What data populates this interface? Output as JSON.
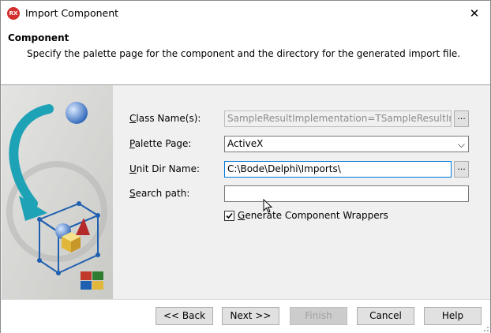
{
  "window": {
    "title": "Import Component",
    "app_icon_text": "RX",
    "close_glyph": "✕"
  },
  "header": {
    "title": "Component",
    "description": "Specify the palette page for the component and the directory for the generated import file."
  },
  "form": {
    "class_name": {
      "label_accel": "C",
      "label_rest": "lass Name(s):",
      "value": "SampleResultImplementation=TSampleResultImplem",
      "enabled": false
    },
    "palette_page": {
      "label_accel": "P",
      "label_rest": "alette Page:",
      "value": "ActiveX"
    },
    "unit_dir": {
      "label_accel": "U",
      "label_rest": "nit Dir Name:",
      "value": "C:\\Bode\\Delphi\\Imports\\"
    },
    "search_path": {
      "label_accel": "S",
      "label_rest": "earch path:",
      "value": ""
    },
    "generate_wrappers": {
      "label_accel": "G",
      "label_rest": "enerate Component Wrappers",
      "checked": true
    },
    "browse_label": "...",
    "dropdown_glyph": "⌵"
  },
  "buttons": {
    "back": "<< Back",
    "next": "Next >>",
    "finish": "Finish",
    "cancel": "Cancel",
    "help": "Help"
  },
  "colors": {
    "accent": "#0078d7",
    "panel": "#f0f0f0",
    "art_cyan": "#1ea2b5",
    "art_blue": "#1f5fb0"
  }
}
